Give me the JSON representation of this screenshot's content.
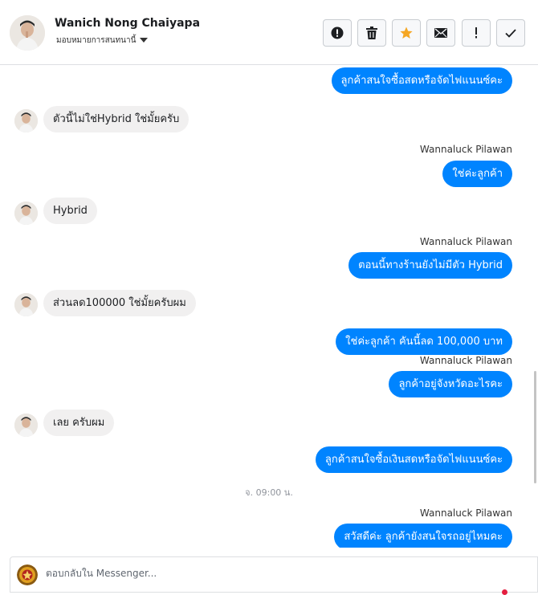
{
  "header": {
    "contact_name": "Wanich Nong Chaiyapa",
    "assign_label": "มอบหมายการสนทนานี้"
  },
  "toolbar": {
    "buttons": [
      {
        "name": "alert-button",
        "icon": "alert-circle-icon"
      },
      {
        "name": "delete-button",
        "icon": "trash-icon"
      },
      {
        "name": "star-button",
        "icon": "star-icon",
        "color": "#f5a623"
      },
      {
        "name": "mark-unread-button",
        "icon": "envelope-icon"
      },
      {
        "name": "follow-up-button",
        "icon": "exclamation-icon"
      },
      {
        "name": "mark-done-button",
        "icon": "check-icon"
      }
    ]
  },
  "messages": [
    {
      "side": "out",
      "sender": "",
      "text": "ลูกค้าสนใจซื้อสดหรือจัดไฟแนนซ์คะ"
    },
    {
      "side": "in",
      "text": "ตัวนี้ไม่ใช่Hybrid ใช่มั้ยครับ"
    },
    {
      "side": "out",
      "sender": "Wannaluck Pilawan",
      "text": "ใช่ค่ะลูกค้า"
    },
    {
      "side": "in",
      "text": "Hybrid"
    },
    {
      "side": "out",
      "sender": "Wannaluck Pilawan",
      "text": "ตอนนี้ทางร้านยังไม่มีตัว Hybrid"
    },
    {
      "side": "in",
      "text": "ส่วนลด100000 ใช่มั้ยครับผม"
    },
    {
      "side": "out",
      "sender": "",
      "text": "ใช่ค่ะลูกค้า คันนี้ลด 100,000 บาท"
    },
    {
      "side": "out",
      "sender": "Wannaluck Pilawan",
      "text": "ลูกค้าอยู่จังหวัดอะไรคะ"
    },
    {
      "side": "in",
      "text": "เลย ครับผม"
    },
    {
      "side": "out",
      "sender": "",
      "text": "ลูกค้าสนใจซื้อเงินสดหรือจัดไฟแนนซ์คะ"
    },
    {
      "side": "time",
      "text": "จ. 09:00 น."
    },
    {
      "side": "out",
      "sender": "Wannaluck Pilawan",
      "text": "สวัสดีค่ะ  ลูกค้ายังสนใจรถอยู่ไหมคะ"
    }
  ],
  "composer": {
    "placeholder": "ตอบกลับใน Messenger..."
  },
  "colors": {
    "outgoing_bubble": "#0084ff",
    "incoming_bubble": "#f1f0f0",
    "star": "#f5a623"
  }
}
